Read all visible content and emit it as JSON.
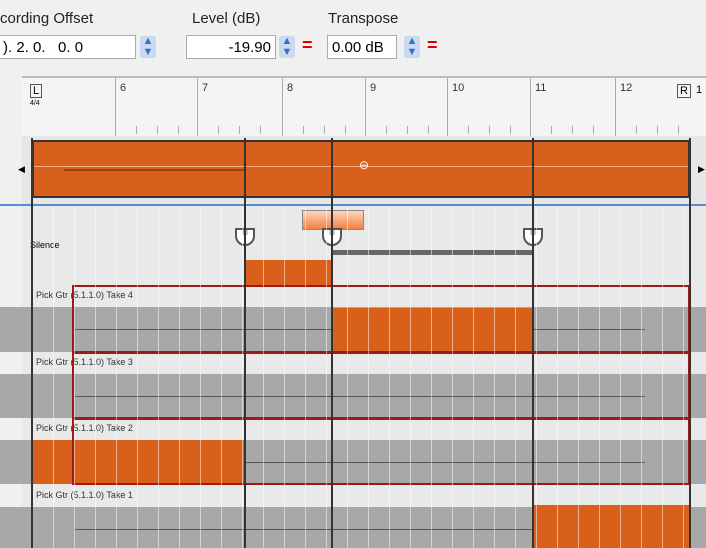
{
  "toolbar": {
    "recording_offset": {
      "label": "cording Offset",
      "value": "). 2. 0.   0. 0"
    },
    "level": {
      "label": "Level (dB)",
      "value": "-19.90"
    },
    "transpose": {
      "label": "Transpose",
      "value": "0.00 dB"
    },
    "equals": "="
  },
  "ruler": {
    "bars": [
      "6",
      "7",
      "8",
      "9",
      "10",
      "11",
      "12"
    ],
    "left_locator": "L",
    "time_signature": "4/4",
    "right_locator": "R",
    "right_edge": "1"
  },
  "silence_lane": {
    "label": "Silence"
  },
  "takes": [
    {
      "label": "Pick Gtr (5.1.1.0) Take 4"
    },
    {
      "label": "Pick Gtr (5.1.1.0) Take 3"
    },
    {
      "label": "Pick Gtr (5.1.1.0) Take 2"
    },
    {
      "label": "Pick Gtr (5.1.1.0) Take 1"
    }
  ],
  "colors": {
    "accent": "#d8601a",
    "selection": "#a01818",
    "blue_line": "#5a8ad8"
  }
}
